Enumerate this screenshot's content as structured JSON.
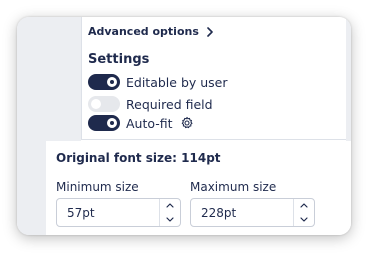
{
  "advanced": {
    "label": "Advanced options",
    "icon": "chevron-right-icon"
  },
  "settings": {
    "heading": "Settings",
    "toggles": [
      {
        "label": "Editable by user",
        "on": true
      },
      {
        "label": "Required field",
        "on": false
      },
      {
        "label": "Auto-fit",
        "on": true,
        "icon": "gear-icon"
      }
    ]
  },
  "font_size": {
    "original_label": "Original font size: 114pt",
    "minimum": {
      "label": "Minimum size",
      "value": "57pt"
    },
    "maximum": {
      "label": "Maximum size",
      "value": "228pt"
    }
  },
  "colors": {
    "text": "#1f2a4d",
    "toggle_on": "#1f2a4d",
    "toggle_off": "#e6e8ec",
    "background_gray": "#eceef2"
  }
}
